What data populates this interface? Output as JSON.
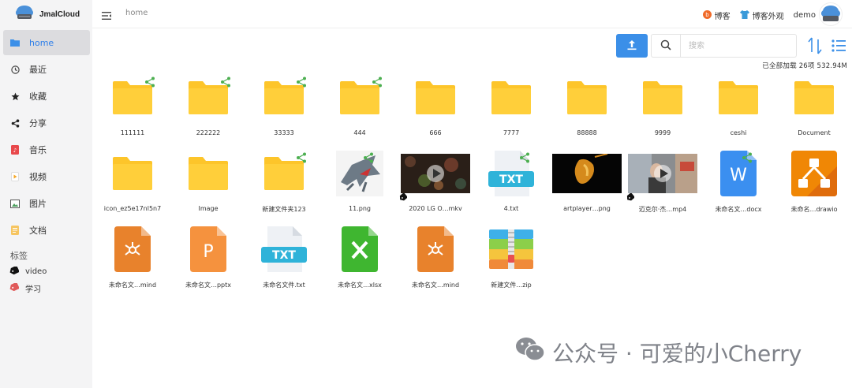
{
  "app": {
    "name": "JmalCloud"
  },
  "sidebar": {
    "items": [
      {
        "label": "home",
        "icon": "folder-icon",
        "active": true
      },
      {
        "label": "最近",
        "icon": "clock-icon"
      },
      {
        "label": "收藏",
        "icon": "star-icon"
      },
      {
        "label": "分享",
        "icon": "share-icon"
      },
      {
        "label": "音乐",
        "icon": "music-file-icon"
      },
      {
        "label": "视频",
        "icon": "video-file-icon"
      },
      {
        "label": "图片",
        "icon": "image-file-icon"
      },
      {
        "label": "文档",
        "icon": "document-file-icon"
      }
    ],
    "tags_title": "标签",
    "tags": [
      {
        "label": "video",
        "color": "#111111"
      },
      {
        "label": "学习",
        "color": "#e05a5a"
      }
    ]
  },
  "header": {
    "breadcrumb": "home",
    "blog_label": "博客",
    "blog_appearance_label": "博客外观",
    "user_name": "demo"
  },
  "toolbar": {
    "search_placeholder": "搜索"
  },
  "status": {
    "loaded": "已全部加载",
    "count": "26项",
    "size": "532.94M"
  },
  "files": [
    {
      "name": "111111",
      "kind": "folder",
      "shared": true
    },
    {
      "name": "222222",
      "kind": "folder",
      "shared": true
    },
    {
      "name": "33333",
      "kind": "folder",
      "shared": true
    },
    {
      "name": "444",
      "kind": "folder",
      "shared": true
    },
    {
      "name": "666",
      "kind": "folder"
    },
    {
      "name": "7777",
      "kind": "folder"
    },
    {
      "name": "88888",
      "kind": "folder"
    },
    {
      "name": "9999",
      "kind": "folder"
    },
    {
      "name": "ceshi",
      "kind": "folder"
    },
    {
      "name": "Document",
      "kind": "folder"
    },
    {
      "name": "icon_ez5e17nl5n7",
      "kind": "folder"
    },
    {
      "name": "Image",
      "kind": "folder"
    },
    {
      "name": "新建文件夹123",
      "kind": "folder",
      "shared": true
    },
    {
      "name": "11.png",
      "kind": "image-shark",
      "shared": true
    },
    {
      "name": "2020 LG O…mkv",
      "kind": "video-dark",
      "tagged": true
    },
    {
      "name": "4.txt",
      "kind": "txt-thumb",
      "shared": true
    },
    {
      "name": "artplayer…png",
      "kind": "image-dark"
    },
    {
      "name": "迈克尔·杰…mp4",
      "kind": "video-person",
      "tagged": true
    },
    {
      "name": "未命名文…docx",
      "kind": "docx",
      "shared": true
    },
    {
      "name": "未命名…drawio",
      "kind": "drawio"
    },
    {
      "name": "未命名文…mind",
      "kind": "mind"
    },
    {
      "name": "未命名文…pptx",
      "kind": "pptx"
    },
    {
      "name": "未命名文件.txt",
      "kind": "txt-thumb"
    },
    {
      "name": "未命名文…xlsx",
      "kind": "xlsx"
    },
    {
      "name": "未命名文…mind",
      "kind": "mind"
    },
    {
      "name": "新建文件…zip",
      "kind": "zip"
    }
  ],
  "watermark": "公众号 · 可爱的小Cherry",
  "colors": {
    "accent": "#3b8fe8",
    "folder": "#fdc52a",
    "share_badge": "#4caf50",
    "sidebar_bg": "#f4f4f5"
  }
}
